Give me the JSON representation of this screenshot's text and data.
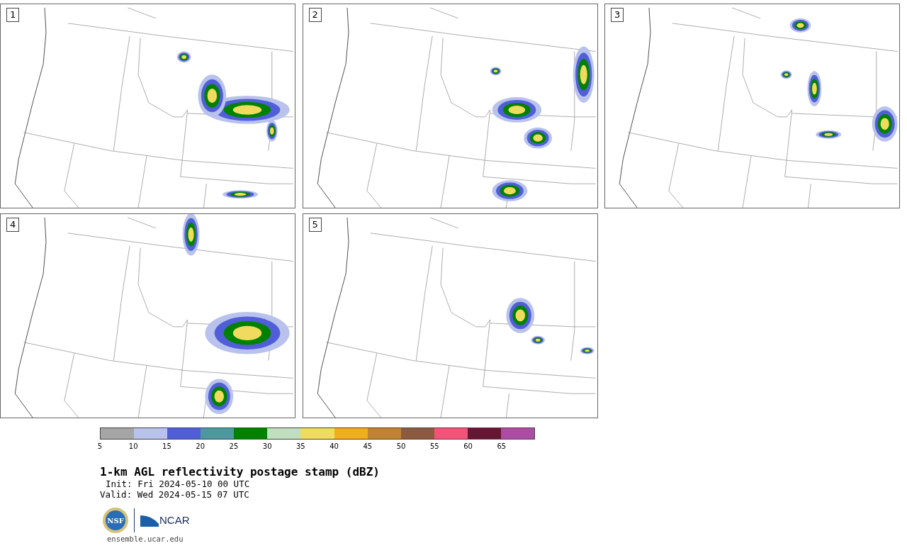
{
  "panels": [
    {
      "label": "1"
    },
    {
      "label": "2"
    },
    {
      "label": "3"
    },
    {
      "label": "4"
    },
    {
      "label": "5"
    }
  ],
  "colorbar": {
    "segments": [
      {
        "color": "#a5a5a5"
      },
      {
        "color": "#b8c2ec"
      },
      {
        "color": "#505fd7"
      },
      {
        "color": "#4e979f"
      },
      {
        "color": "#008100"
      },
      {
        "color": "#bfdfbf"
      },
      {
        "color": "#f1db5e"
      },
      {
        "color": "#f0ae1b"
      },
      {
        "color": "#bf8332"
      },
      {
        "color": "#8c5a3e"
      },
      {
        "color": "#f5527a"
      },
      {
        "color": "#641633"
      },
      {
        "color": "#ad4ca5"
      }
    ],
    "ticks": [
      "5",
      "10",
      "15",
      "20",
      "25",
      "30",
      "35",
      "40",
      "45",
      "50",
      "55",
      "60",
      "65"
    ]
  },
  "title": "1-km AGL reflectivity postage stamp (dBZ)",
  "init": "Init: Fri 2024-05-10 00 UTC",
  "valid": "Valid: Wed 2024-05-15 07 UTC",
  "logo": {
    "nsf": "NSF",
    "ncar": "NCAR"
  },
  "site": "ensemble.ucar.edu"
}
